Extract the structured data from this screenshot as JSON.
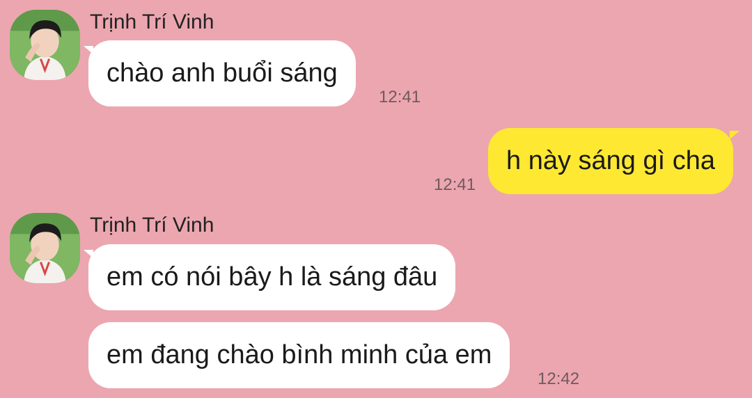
{
  "colors": {
    "background": "#eca6b0",
    "incoming_bubble": "#ffffff",
    "outgoing_bubble": "#fee832",
    "timestamp": "#6f5a5e"
  },
  "messages": [
    {
      "sender": "Trịnh Trí Vinh",
      "text": "chào anh buổi sáng",
      "time": "12:41",
      "direction": "incoming"
    },
    {
      "text": "h này sáng gì cha",
      "time": "12:41",
      "direction": "outgoing"
    },
    {
      "sender": "Trịnh Trí Vinh",
      "text": "em có nói bây h là sáng đâu",
      "direction": "incoming"
    },
    {
      "text": "em đang chào bình minh của em",
      "time": "12:42",
      "direction": "incoming"
    }
  ],
  "avatar_icon": "user-avatar-icon"
}
